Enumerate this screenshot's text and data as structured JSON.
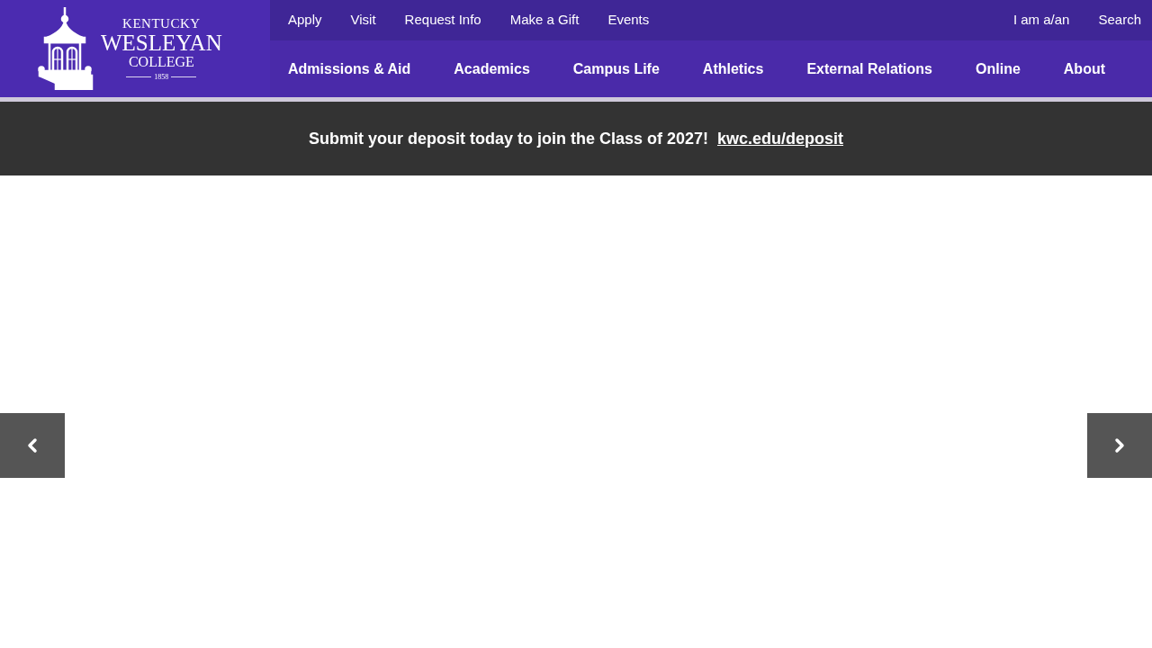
{
  "logo": {
    "line_1": "KENTUCKY",
    "line_2": "WESLEYAN",
    "line_3": "COLLEGE",
    "year": "1858"
  },
  "utility_links": [
    "Apply",
    "Visit",
    "Request Info",
    "Make a Gift",
    "Events"
  ],
  "utility_links_right": [
    "I am a/an",
    "Search"
  ],
  "main_nav": [
    "Admissions & Aid",
    "Academics",
    "Campus Life",
    "Athletics",
    "External Relations",
    "Online",
    "About"
  ],
  "banner": {
    "message": "Submit your deposit today to join the Class of 2027!",
    "link": "kwc.edu/deposit"
  }
}
